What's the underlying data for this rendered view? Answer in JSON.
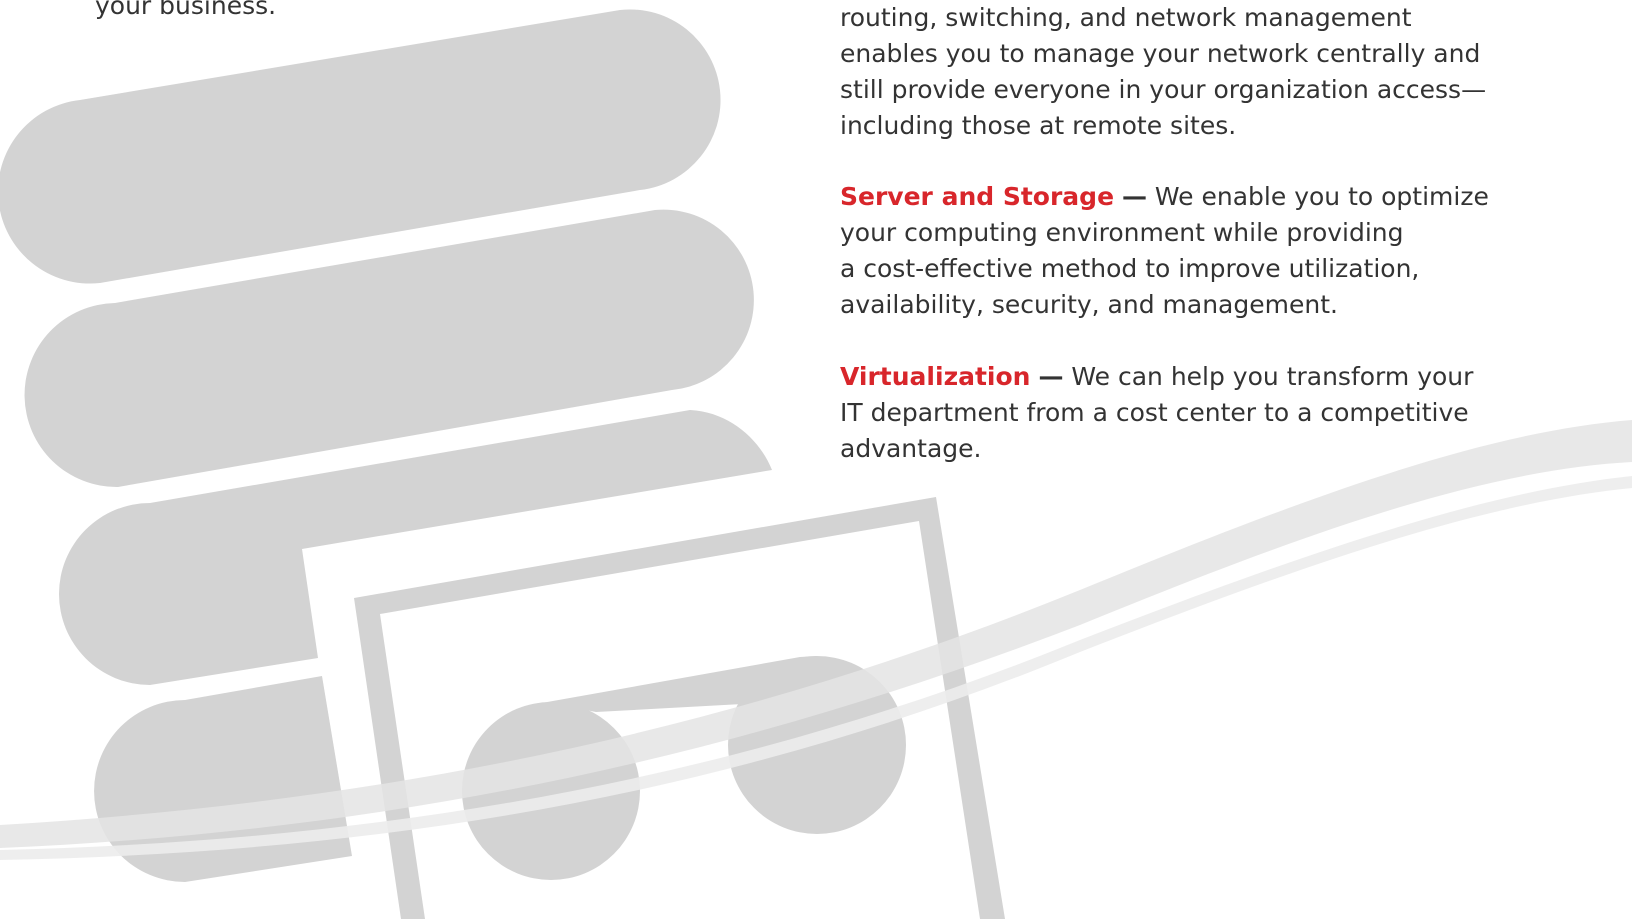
{
  "left": {
    "text": "your business."
  },
  "right": {
    "intro_lines": [
      "routing, switching, and network management",
      "enables you to manage your network centrally and",
      "still provide everyone in your organization access—",
      "including those at remote sites."
    ],
    "sections": [
      {
        "term": "Server and Storage",
        "dash": "—",
        "first_line": " We enable you to optimize",
        "lines": [
          "your computing environment while providing",
          "a cost-effective method to improve utilization,",
          "availability, security, and management."
        ]
      },
      {
        "term": "Virtualization",
        "dash": "—",
        "first_line": " We can help you transform your",
        "lines": [
          "IT department from a cost center to a competitive",
          "advantage."
        ]
      }
    ]
  },
  "colors": {
    "accent_red": "#d8262b",
    "body_text": "#333333",
    "graphic_gray": "#d3d3d3",
    "swoosh_gray": "#e4e4e4"
  }
}
